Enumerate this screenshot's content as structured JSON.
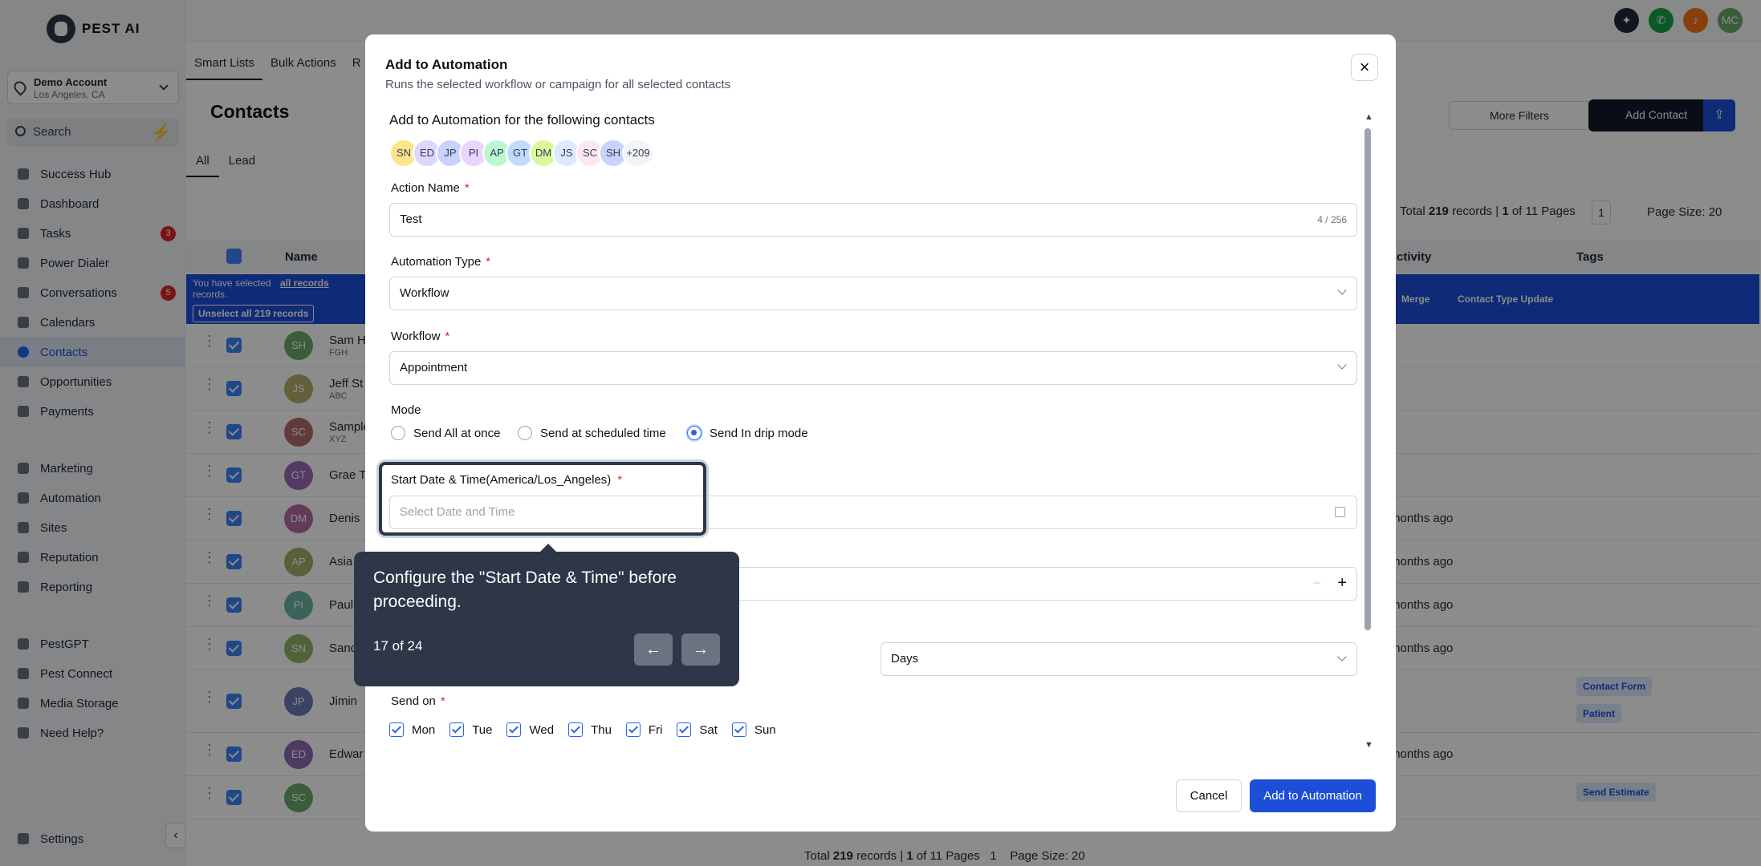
{
  "brand": {
    "name": "PEST AI"
  },
  "account": {
    "name": "Demo Account",
    "location": "Los Angeles, CA"
  },
  "search": {
    "label": "Search"
  },
  "nav": [
    {
      "label": "Success Hub"
    },
    {
      "label": "Dashboard"
    },
    {
      "label": "Tasks",
      "badge": "3"
    },
    {
      "label": "Power Dialer"
    },
    {
      "label": "Conversations",
      "badge": "5"
    },
    {
      "label": "Calendars"
    },
    {
      "label": "Contacts"
    },
    {
      "label": "Opportunities"
    },
    {
      "label": "Payments"
    },
    {
      "label": "Marketing"
    },
    {
      "label": "Automation"
    },
    {
      "label": "Sites"
    },
    {
      "label": "Reputation"
    },
    {
      "label": "Reporting"
    },
    {
      "label": "PestGPT"
    },
    {
      "label": "Pest Connect"
    },
    {
      "label": "Media Storage"
    },
    {
      "label": "Need Help?"
    },
    {
      "label": "Settings"
    }
  ],
  "topbar": {
    "avatar": "MC"
  },
  "tabs": [
    "Smart Lists",
    "Bulk Actions",
    "R"
  ],
  "page": {
    "title": "Contacts",
    "filters": [
      "All",
      "Lead"
    ],
    "more_filters": "More Filters",
    "add_contact": "Add Contact",
    "total": "Total",
    "total_count": "219",
    "records": "records |",
    "page_current": "1",
    "of_pages": "of 11 Pages",
    "page_num": "1",
    "page_size": "Page Size: 20"
  },
  "table": {
    "col_name": "Name",
    "col_activity": "ctivity",
    "col_tags": "Tags",
    "selected_text": "You have selected",
    "all_records": "all records",
    "records": "records.",
    "unselect": "Unselect all 219 records",
    "merge": "Merge",
    "contact_type_update": "Contact Type Update"
  },
  "rows": [
    {
      "initials": "SH",
      "name": "Sam H",
      "sub": "FGH",
      "color": "#6aa96a"
    },
    {
      "initials": "JS",
      "name": "Jeff St",
      "sub": "ABC",
      "color": "#b5b06a"
    },
    {
      "initials": "SC",
      "name": "Sample",
      "sub": "XYZ",
      "color": "#b56a6a"
    },
    {
      "initials": "GT",
      "name": "Grae T",
      "sub": "",
      "color": "#9a6ab5"
    },
    {
      "initials": "DM",
      "name": "Denis",
      "sub": "",
      "color": "#b56aa5",
      "ago": "months ago"
    },
    {
      "initials": "AP",
      "name": "Asia",
      "sub": "",
      "color": "#a3b06a",
      "ago": "months ago"
    },
    {
      "initials": "PI",
      "name": "Paul",
      "sub": "",
      "color": "#6ab5a3",
      "ago": "months ago"
    },
    {
      "initials": "SN",
      "name": "Sand",
      "sub": "",
      "color": "#8fb56a",
      "ago": "months ago"
    },
    {
      "initials": "JP",
      "name": "Jimin",
      "sub": "",
      "color": "#6a7bb5",
      "tags": [
        "Contact Form",
        "Patient"
      ]
    },
    {
      "initials": "ED",
      "name": "Edwar",
      "sub": "",
      "color": "#8a6ab5",
      "ago": "months ago"
    },
    {
      "initials": "SC",
      "name": "",
      "sub": "",
      "color": "#6aa96a",
      "tags": [
        "Send Estimate"
      ]
    }
  ],
  "modal": {
    "title": "Add to Automation",
    "subtitle": "Runs the selected workflow or campaign for all selected contacts",
    "section": "Add to Automation for the following contacts",
    "avatars": [
      {
        "t": "SN",
        "c": "#fde68a"
      },
      {
        "t": "ED",
        "c": "#ddd6fe"
      },
      {
        "t": "JP",
        "c": "#c7d2fe"
      },
      {
        "t": "PI",
        "c": "#e9d5ff"
      },
      {
        "t": "AP",
        "c": "#bbf7d0"
      },
      {
        "t": "GT",
        "c": "#bfdbfe"
      },
      {
        "t": "DM",
        "c": "#d9f99d"
      },
      {
        "t": "JS",
        "c": "#dbeafe"
      },
      {
        "t": "SC",
        "c": "#fce7f3"
      },
      {
        "t": "SH",
        "c": "#c7d2fe"
      },
      {
        "t": "+209",
        "c": "#f3f4f6"
      }
    ],
    "action_name_label": "Action Name",
    "action_name_value": "Test",
    "action_name_count": "4 / 256",
    "automation_type_label": "Automation Type",
    "automation_type_value": "Workflow",
    "workflow_label": "Workflow",
    "workflow_value": "Appointment",
    "mode_label": "Mode",
    "mode_options": [
      "Send All at once",
      "Send at scheduled time",
      "Send In drip mode"
    ],
    "start_label": "Start Date & Time(America/Los_Angeles)",
    "start_placeholder": "Select Date and Time",
    "days_value": "Days",
    "send_on_label": "Send on",
    "days": [
      "Mon",
      "Tue",
      "Wed",
      "Thu",
      "Fri",
      "Sat",
      "Sun"
    ],
    "cancel": "Cancel",
    "submit": "Add to Automation"
  },
  "tooltip": {
    "text": "Configure the \"Start Date & Time\" before proceeding.",
    "counter": "17 of 24"
  },
  "colors": {
    "primary": "#1d4ed8",
    "overlay": "rgba(0,0,0,0.45)",
    "tooltip_bg": "#2d3748"
  }
}
